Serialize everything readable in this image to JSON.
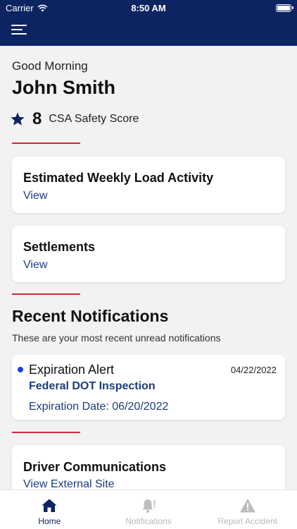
{
  "status_bar": {
    "carrier": "Carrier",
    "time": "8:50 AM"
  },
  "header": {
    "menu_icon": "hamburger-menu-icon"
  },
  "greeting": "Good Morning",
  "user": {
    "name": "John Smith"
  },
  "safety": {
    "score": "8",
    "label": "CSA Safety Score",
    "icon": "star-icon"
  },
  "cards": [
    {
      "title": "Estimated Weekly Load Activity",
      "link": "View"
    },
    {
      "title": "Settlements",
      "link": "View"
    },
    {
      "title": "Driver Communications",
      "link": "View External Site"
    }
  ],
  "notifications_section": {
    "title": "Recent Notifications",
    "subtitle": "These are your most recent unread notifications",
    "items": [
      {
        "title": "Expiration Alert",
        "date": "04/22/2022",
        "subtitle": "Federal DOT Inspection",
        "detail": "Expiration Date: 06/20/2022"
      }
    ]
  },
  "tabs": [
    {
      "label": "Home",
      "icon": "home-icon",
      "active": true
    },
    {
      "label": "Notifications",
      "icon": "bell-icon",
      "active": false
    },
    {
      "label": "Report Accident",
      "icon": "warning-icon",
      "active": false
    }
  ],
  "colors": {
    "header_bg": "#0c2461",
    "accent_red": "#d2263a",
    "link_blue": "#1c3d7a",
    "unread_dot": "#1f3fd8"
  }
}
